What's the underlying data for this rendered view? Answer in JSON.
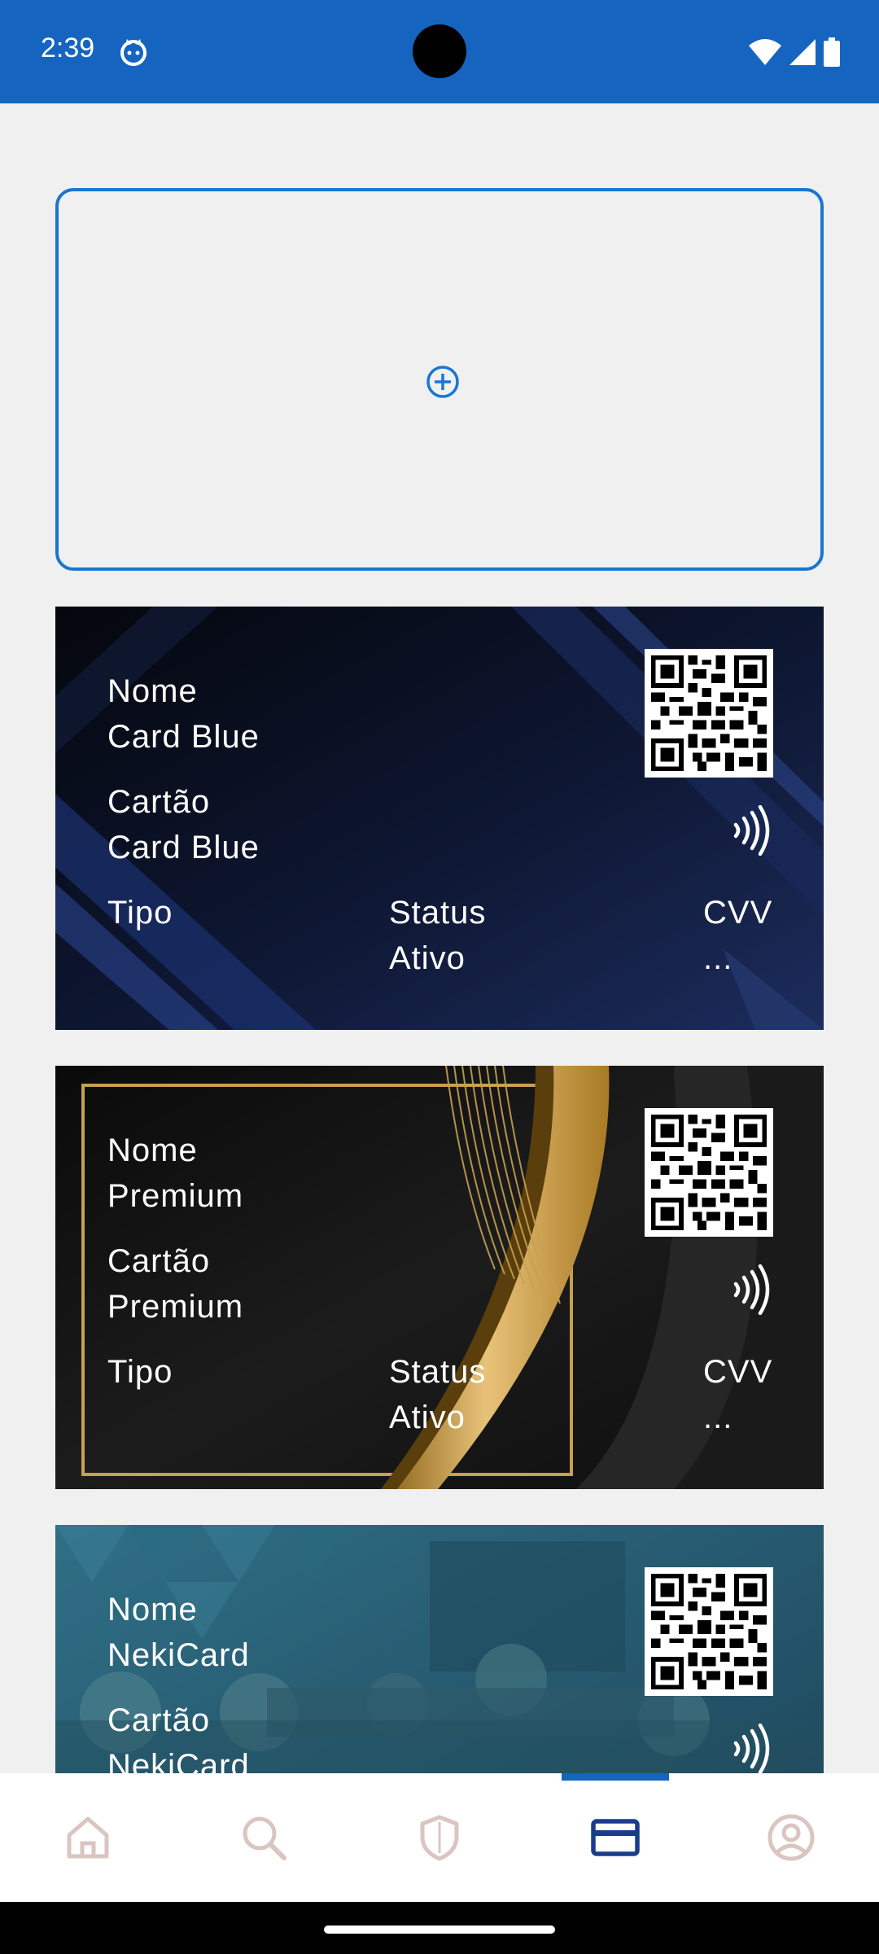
{
  "status_bar": {
    "time": "2:39"
  },
  "add_card": {
    "icon": "add-circle-icon",
    "color": "#1976d2"
  },
  "cards": [
    {
      "nome_label": "Nome",
      "nome_value": "Card Blue",
      "cartao_label": "Cartão",
      "cartao_value": "Card Blue",
      "tipo_label": "Tipo",
      "status_label": "Status",
      "status_value": "Ativo",
      "cvv_label": "CVV",
      "cvv_value": "..."
    },
    {
      "nome_label": "Nome",
      "nome_value": "Premium",
      "cartao_label": "Cartão",
      "cartao_value": "Premium",
      "tipo_label": "Tipo",
      "status_label": "Status",
      "status_value": "Ativo",
      "cvv_label": "CVV",
      "cvv_value": "..."
    },
    {
      "nome_label": "Nome",
      "nome_value": "NekiCard",
      "cartao_label": "Cartão",
      "cartao_value": "NekiCard"
    }
  ],
  "bottom_nav": {
    "items": [
      {
        "icon": "home-icon",
        "active": false
      },
      {
        "icon": "search-icon",
        "active": false
      },
      {
        "icon": "shield-icon",
        "active": false
      },
      {
        "icon": "credit-card-icon",
        "active": true
      },
      {
        "icon": "account-circle-icon",
        "active": false
      }
    ],
    "active_color": "#1a3c8c",
    "inactive_color": "#d9c6c0"
  },
  "colors": {
    "status_bar": "#1565c0",
    "background": "#f0f0f0"
  }
}
